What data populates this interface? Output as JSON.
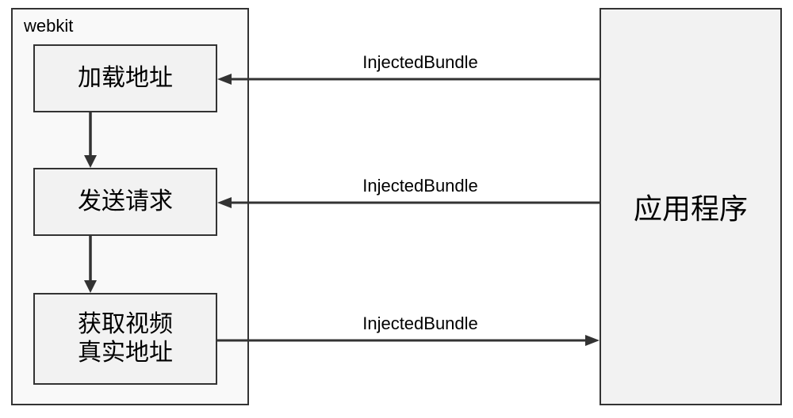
{
  "chart_data": {
    "type": "diagram",
    "title": "",
    "containers": [
      {
        "id": "webkit",
        "label": "webkit"
      }
    ],
    "nodes": [
      {
        "id": "load_addr",
        "label": "加载地址",
        "container": "webkit"
      },
      {
        "id": "send_req",
        "label": "发送请求",
        "container": "webkit"
      },
      {
        "id": "get_video",
        "label": "获取视频\n真实地址",
        "container": "webkit"
      },
      {
        "id": "application",
        "label": "应用程序",
        "container": null
      }
    ],
    "edges": [
      {
        "from": "application",
        "to": "load_addr",
        "label": "InjectedBundle",
        "dir": "left"
      },
      {
        "from": "application",
        "to": "send_req",
        "label": "InjectedBundle",
        "dir": "left"
      },
      {
        "from": "get_video",
        "to": "application",
        "label": "InjectedBundle",
        "dir": "right"
      },
      {
        "from": "load_addr",
        "to": "send_req",
        "label": "",
        "dir": "down"
      },
      {
        "from": "send_req",
        "to": "get_video",
        "label": "",
        "dir": "down"
      }
    ]
  },
  "labels": {
    "webkit_title": "webkit",
    "load_addr": "加载地址",
    "send_req": "发送请求",
    "get_video_l1": "获取视频",
    "get_video_l2": "真实地址",
    "application": "应用程序",
    "edge1": "InjectedBundle",
    "edge2": "InjectedBundle",
    "edge3": "InjectedBundle"
  }
}
